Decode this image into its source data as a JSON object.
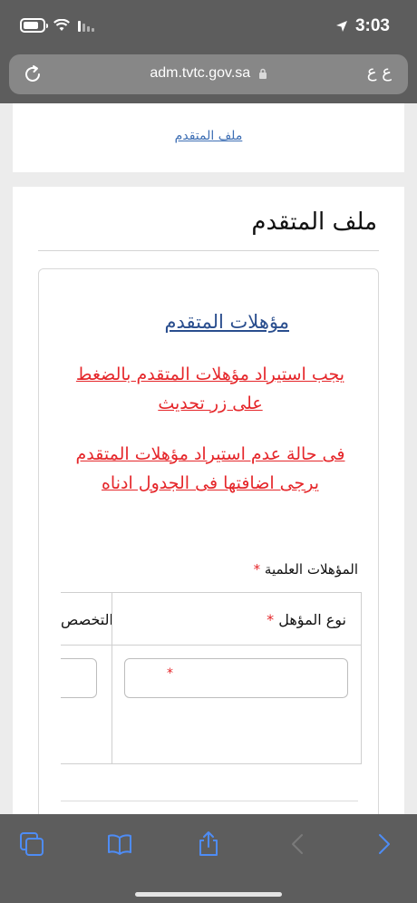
{
  "status_bar": {
    "time": "3:03",
    "battery_level": 0.8
  },
  "browser": {
    "url": "adm.tvtc.gov.sa",
    "text_size_button": "ع ع"
  },
  "page": {
    "top_link": "ملف المتقدم",
    "title": "ملف المتقدم",
    "section_link": "مؤهلات المتقدم",
    "warning_1": "يجب استيراد مؤهلات المتقدم بالضغط على زر تحديث",
    "warning_2": "فى حالة عدم استيراد مؤهلات المتقدم يرجى اضافتها فى الجدول ادناه",
    "qualifications_label": "المؤهلات العلمية",
    "required_mark": "*",
    "table": {
      "col_type": "نوع المؤهل",
      "col_specialization": "التخصص"
    }
  },
  "toolbar": {
    "icons": [
      "tabs-icon",
      "bookmarks-icon",
      "share-icon",
      "back-icon",
      "forward-icon"
    ]
  },
  "colors": {
    "chrome": "#5d5d5d",
    "link": "#3e6fb4",
    "warning": "#e5262a",
    "ios_blue": "#4e8cf5"
  }
}
